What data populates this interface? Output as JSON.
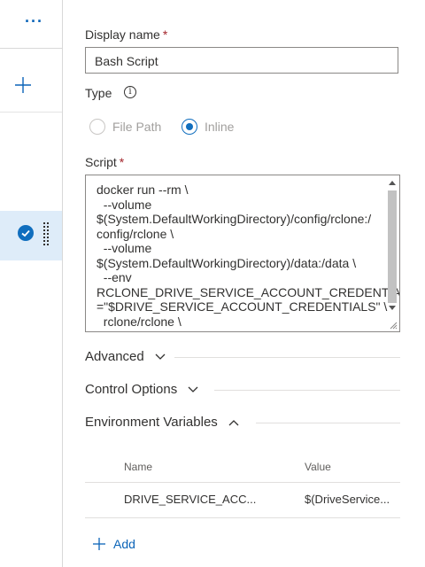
{
  "left_panel": {
    "more_label": "···",
    "add_icon": "plus-icon",
    "selected_item_icon": "check-circle-icon",
    "drag_icon": "grip-icon"
  },
  "form": {
    "display_name": {
      "label": "Display name",
      "required_mark": "*",
      "value": "Bash Script"
    },
    "type": {
      "label": "Type",
      "info_icon": "info-icon",
      "options": [
        {
          "label": "File Path",
          "selected": false
        },
        {
          "label": "Inline",
          "selected": true
        }
      ]
    },
    "script": {
      "label": "Script",
      "required_mark": "*",
      "lines": [
        "docker run --rm \\",
        "  --volume",
        "$(System.DefaultWorkingDirectory)/config/rclone:/",
        "config/rclone \\",
        "  --volume",
        "$(System.DefaultWorkingDirectory)/data:/data \\",
        "  --env",
        "RCLONE_DRIVE_SERVICE_ACCOUNT_CREDENTIALS",
        "=\"$DRIVE_SERVICE_ACCOUNT_CREDENTIALS\" \\",
        "  rclone/rclone \\"
      ]
    }
  },
  "sections": {
    "advanced": "Advanced",
    "control_options": "Control Options",
    "environment_variables": "Environment Variables"
  },
  "env_table": {
    "columns": [
      "Name",
      "Value"
    ],
    "rows": [
      {
        "name": "DRIVE_SERVICE_ACC...",
        "value": "$(DriveService..."
      }
    ],
    "add_label": "Add"
  },
  "colors": {
    "accent": "#106ebe",
    "link": "#0b64b8",
    "selected_bg": "#deecf9",
    "required": "#a4262c"
  }
}
